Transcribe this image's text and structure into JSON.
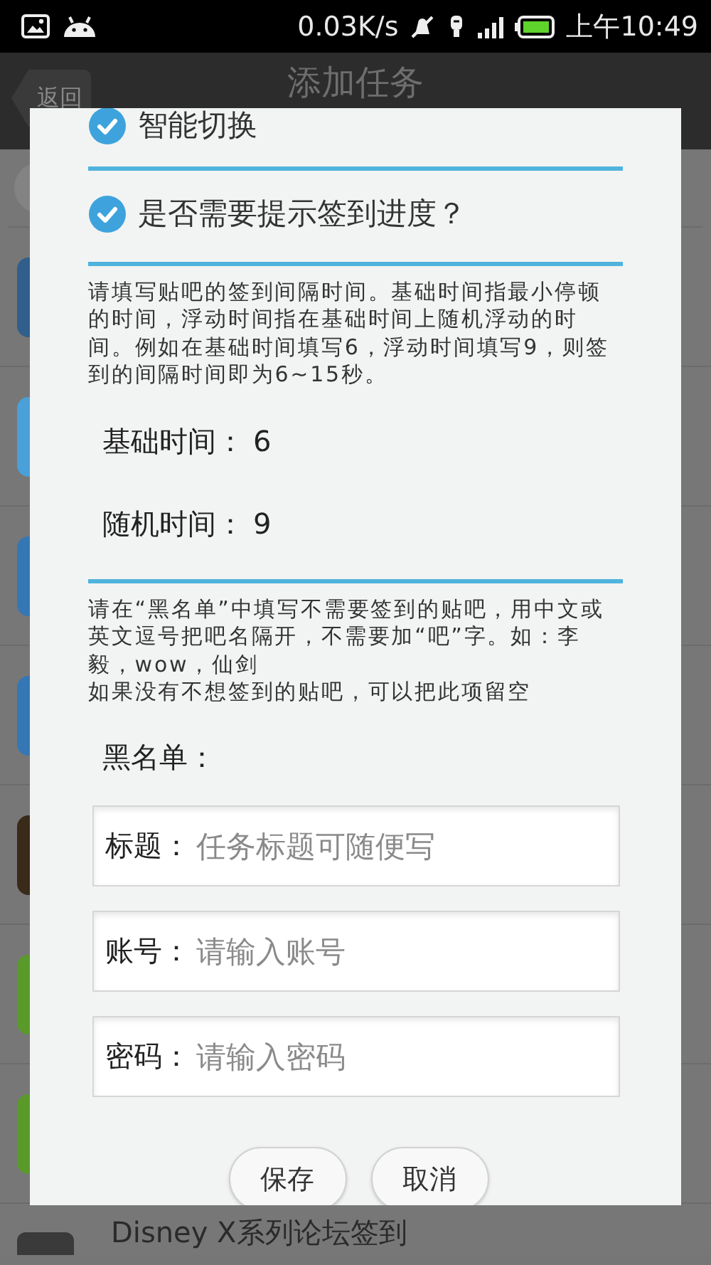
{
  "status_bar": {
    "speed": "0.03K/s",
    "time": "上午10:49"
  },
  "header": {
    "back": "返回",
    "title": "添加任务"
  },
  "background_list": {
    "last_item": "Disney X系列论坛签到"
  },
  "dialog": {
    "options": [
      {
        "label": "智能切换",
        "checked": true
      },
      {
        "label": "是否需要提示签到进度？",
        "checked": true
      }
    ],
    "interval_help": "请填写贴吧的签到间隔时间。基础时间指最小停顿的时间，浮动时间指在基础时间上随机浮动的时间。例如在基础时间填写6，浮动时间填写9，则签到的间隔时间即为6~15秒。",
    "time_fields": [
      {
        "label": "基础时间：",
        "value": "6"
      },
      {
        "label": "随机时间：",
        "value": "9"
      }
    ],
    "blacklist_help": [
      "请在“黑名单”中填写不需要签到的贴吧，用中文或英文逗号把吧名隔开，不需要加“吧”字。如：李毅，wow，仙剑",
      "如果没有不想签到的贴吧，可以把此项留空"
    ],
    "blacklist": {
      "label": "黑名单："
    },
    "fields": [
      {
        "label": "标题：",
        "placeholder": "任务标题可随便写"
      },
      {
        "label": "账号：",
        "placeholder": "请输入账号"
      },
      {
        "label": "密码：",
        "placeholder": "请输入密码"
      }
    ],
    "buttons": [
      "保存",
      "取消"
    ]
  }
}
